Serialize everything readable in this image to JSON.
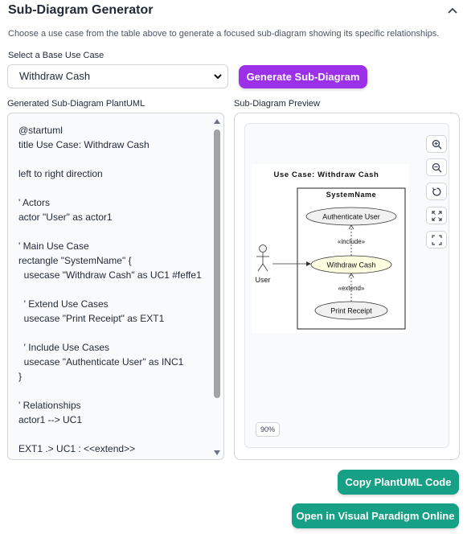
{
  "header": {
    "title": "Sub-Diagram Generator",
    "description": "Choose a use case from the table above to generate a focused sub-diagram showing its specific relationships."
  },
  "selector": {
    "label": "Select a Base Use Case",
    "selected": "Withdraw Cash"
  },
  "generate_button": "Generate Sub-Diagram",
  "code_panel": {
    "label": "Generated Sub-Diagram PlantUML",
    "code": "@startuml\ntitle Use Case: Withdraw Cash\n\nleft to right direction\n\n' Actors\nactor \"User\" as actor1\n\n' Main Use Case\nrectangle \"SystemName\" {\n  usecase \"Withdraw Cash\" as UC1 #feffe1\n\n  ' Extend Use Cases\n  usecase \"Print Receipt\" as EXT1\n\n  ' Include Use Cases\n  usecase \"Authenticate User\" as INC1\n}\n\n' Relationships\nactor1 --> UC1\n\nEXT1 .> UC1 : <<extend>>"
  },
  "preview_panel": {
    "label": "Sub-Diagram Preview",
    "zoom_level": "90%",
    "diagram": {
      "title": "Use Case: Withdraw Cash",
      "system": "SystemName",
      "actor": "User",
      "uc_main": "Withdraw Cash",
      "uc_include": "Authenticate User",
      "uc_extend": "Print Receipt",
      "include_label": "«include»",
      "extend_label": "«extend»",
      "colors": {
        "main_fill": "#feffe1",
        "uc_fill": "#f1f1f1"
      }
    }
  },
  "actions": {
    "copy": "Copy PlantUML Code",
    "open": "Open in Visual Paradigm Online"
  },
  "colors": {
    "primary_purple": "#9b30e8",
    "teal": "#16a085"
  }
}
